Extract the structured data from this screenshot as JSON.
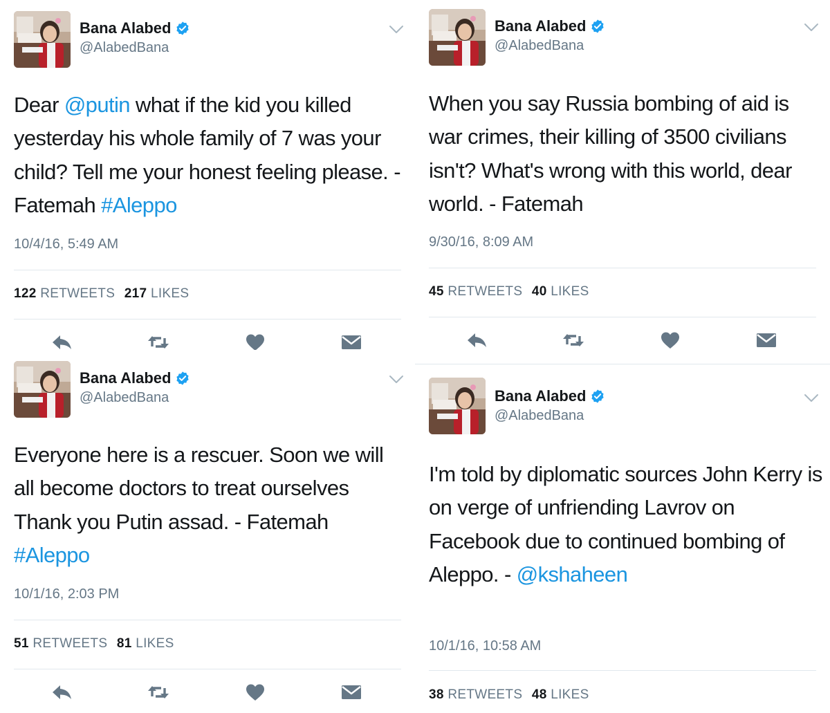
{
  "colors": {
    "link": "#1b95e0",
    "verified": "#1da1f2",
    "secondary_text": "#657786",
    "action_icon": "#657786"
  },
  "icons": {
    "verified": "verified-icon",
    "menu": "chevron-down-icon",
    "reply": "reply-icon",
    "retweet": "retweet-icon",
    "like": "heart-icon",
    "message": "envelope-icon"
  },
  "tweets": [
    {
      "user": {
        "name": "Bana Alabed",
        "handle": "@AlabedBana"
      },
      "text": [
        {
          "t": "Dear "
        },
        {
          "t": "@putin",
          "link": true
        },
        {
          "t": " what if the kid you killed yesterday his whole family of 7 was your child? Tell me your honest feeling please. - Fatemah "
        },
        {
          "t": "#Aleppo",
          "link": true
        }
      ],
      "timestamp": "10/4/16, 5:49 AM",
      "stats": {
        "retweets": "122",
        "retweets_label": "RETWEETS",
        "likes": "217",
        "likes_label": "LIKES"
      }
    },
    {
      "user": {
        "name": "Bana Alabed",
        "handle": "@AlabedBana"
      },
      "text": [
        {
          "t": "When you say Russia bombing of aid is war crimes, their killing of 3500 civilians isn't? What's wrong with this world, dear world. - Fatemah"
        }
      ],
      "timestamp": "9/30/16, 8:09 AM",
      "stats": {
        "retweets": "45",
        "retweets_label": "RETWEETS",
        "likes": "40",
        "likes_label": "LIKES"
      }
    },
    {
      "user": {
        "name": "Bana Alabed",
        "handle": "@AlabedBana"
      },
      "text": [
        {
          "t": "Everyone here is a rescuer. Soon we will all become doctors to treat ourselves Thank you Putin assad. - Fatemah "
        },
        {
          "t": "#Aleppo",
          "link": true
        }
      ],
      "timestamp": "10/1/16, 2:03 PM",
      "stats": {
        "retweets": "51",
        "retweets_label": "RETWEETS",
        "likes": "81",
        "likes_label": "LIKES"
      }
    },
    {
      "user": {
        "name": "Bana Alabed",
        "handle": "@AlabedBana"
      },
      "text": [
        {
          "t": "I'm told by diplomatic sources John Kerry is on verge of unfriending Lavrov on Facebook due to continued bombing of Aleppo. - "
        },
        {
          "t": "@kshaheen",
          "link": true
        }
      ],
      "timestamp": "10/1/16, 10:58 AM",
      "stats": {
        "retweets": "38",
        "retweets_label": "RETWEETS",
        "likes": "48",
        "likes_label": "LIKES"
      }
    }
  ]
}
